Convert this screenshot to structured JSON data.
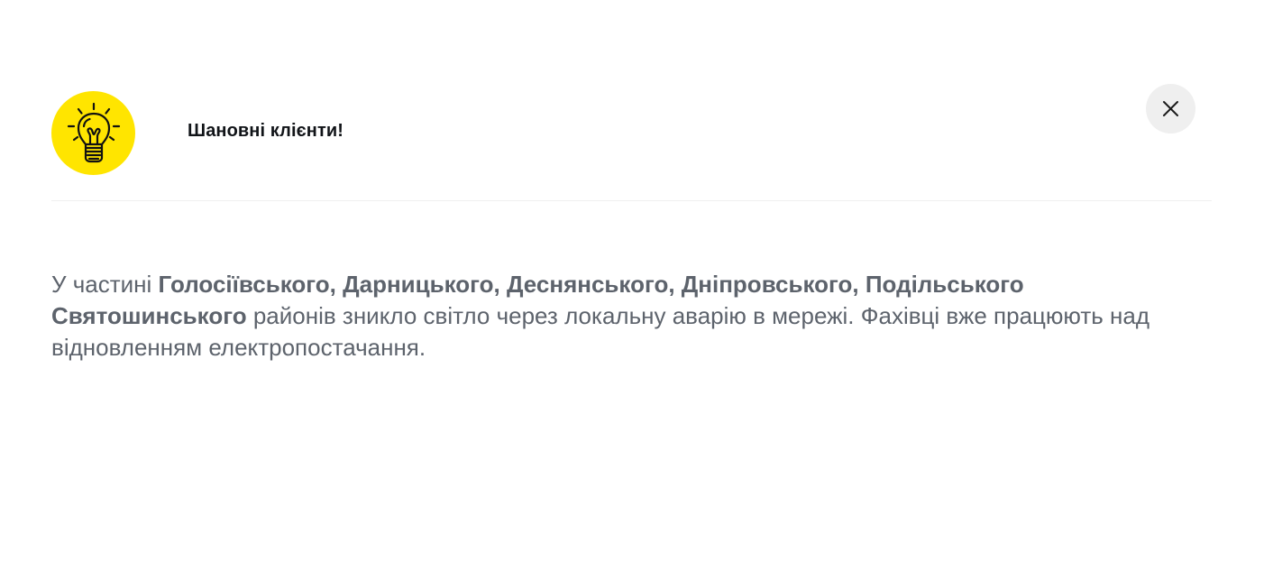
{
  "modal": {
    "title": "Шановні клієнти!",
    "icon": "lightbulb-icon",
    "close_icon": "close-icon",
    "accent_color": "#ffe500",
    "message": {
      "intro": "У частині ",
      "districts": "Голосіївського, Дарницького, Деснянського, Дніпровського, Подільського Святошинського",
      "rest": " районів зникло світло через локальну аварію в мережі. Фахівці вже працюють над відновленням електропостачання."
    }
  }
}
